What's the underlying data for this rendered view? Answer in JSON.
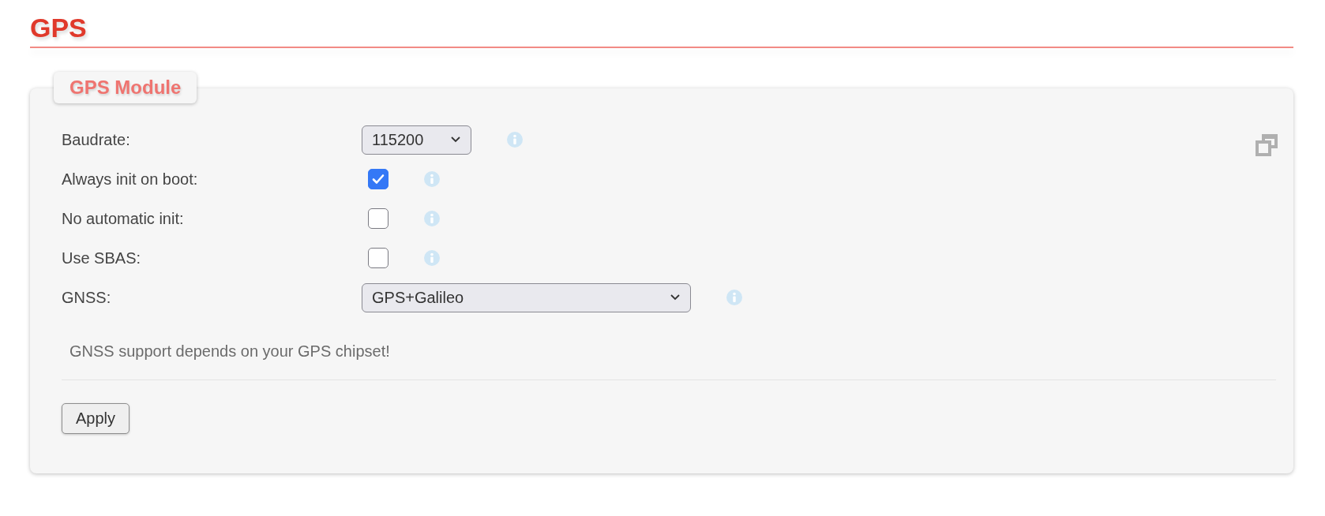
{
  "page_title": "GPS",
  "panel": {
    "legend": "GPS Module",
    "fields": [
      {
        "kind": "select",
        "label": "Baudrate:",
        "value": "115200"
      },
      {
        "kind": "checkbox",
        "label": "Always init on boot:",
        "checked": true
      },
      {
        "kind": "checkbox",
        "label": "No automatic init:",
        "checked": false
      },
      {
        "kind": "checkbox",
        "label": "Use SBAS:",
        "checked": false
      },
      {
        "kind": "select",
        "label": "GNSS:",
        "value": "GPS+Galileo"
      }
    ],
    "note": "GNSS support depends on your GPS chipset!",
    "button": "Apply"
  }
}
